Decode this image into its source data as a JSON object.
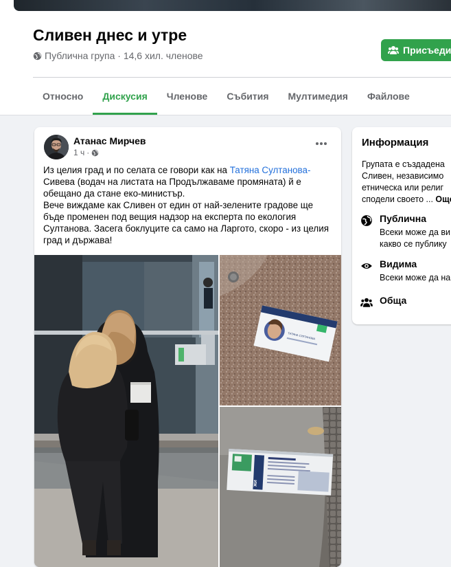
{
  "group": {
    "title": "Сливен днес и утре",
    "meta": "Публична група · 14,6 хил. членове",
    "join_label": "Присъедин"
  },
  "tabs": [
    "Относно",
    "Дискусия",
    "Членове",
    "Събития",
    "Мултимедия",
    "Файлове"
  ],
  "active_tab": "Дискусия",
  "post": {
    "author": "Атанас Мирчев",
    "time": "1 ч",
    "text_before_mention": "Из целия град и по селата се говори как на ",
    "mention": "Татяна Султанова-",
    "text_after_mention": "Сивева (водач на листата на Продължаваме промяната) й е обещано да стане еко-министър.",
    "text_second": "Вече виждаме как Сливен от един от най-зелените градове ще бъде променен под вещия надзор на експерта по екология Султанова. Засега боклуците са само на Ларгото, скоро - из целия град и държава!",
    "leaflet_text": "ТАТЯНА СУЛТАНОВА"
  },
  "info": {
    "title": "Информация",
    "description_lines": [
      "Групата е създадена",
      "Сливен, независимо",
      "етническа или религ",
      "сподели своето ... "
    ],
    "more_label": "Още",
    "items": [
      {
        "icon": "globe-icon",
        "label": "Публична",
        "sub": [
          "Всеки може да ви",
          "какво се публику"
        ]
      },
      {
        "icon": "eye-icon",
        "label": "Видима",
        "sub": [
          "Всеки може да на"
        ]
      },
      {
        "icon": "group-icon",
        "label": "Обща",
        "sub": []
      }
    ]
  },
  "colors": {
    "accent": "#31a24c",
    "link": "#216fdb",
    "secondary_text": "#65676b"
  }
}
